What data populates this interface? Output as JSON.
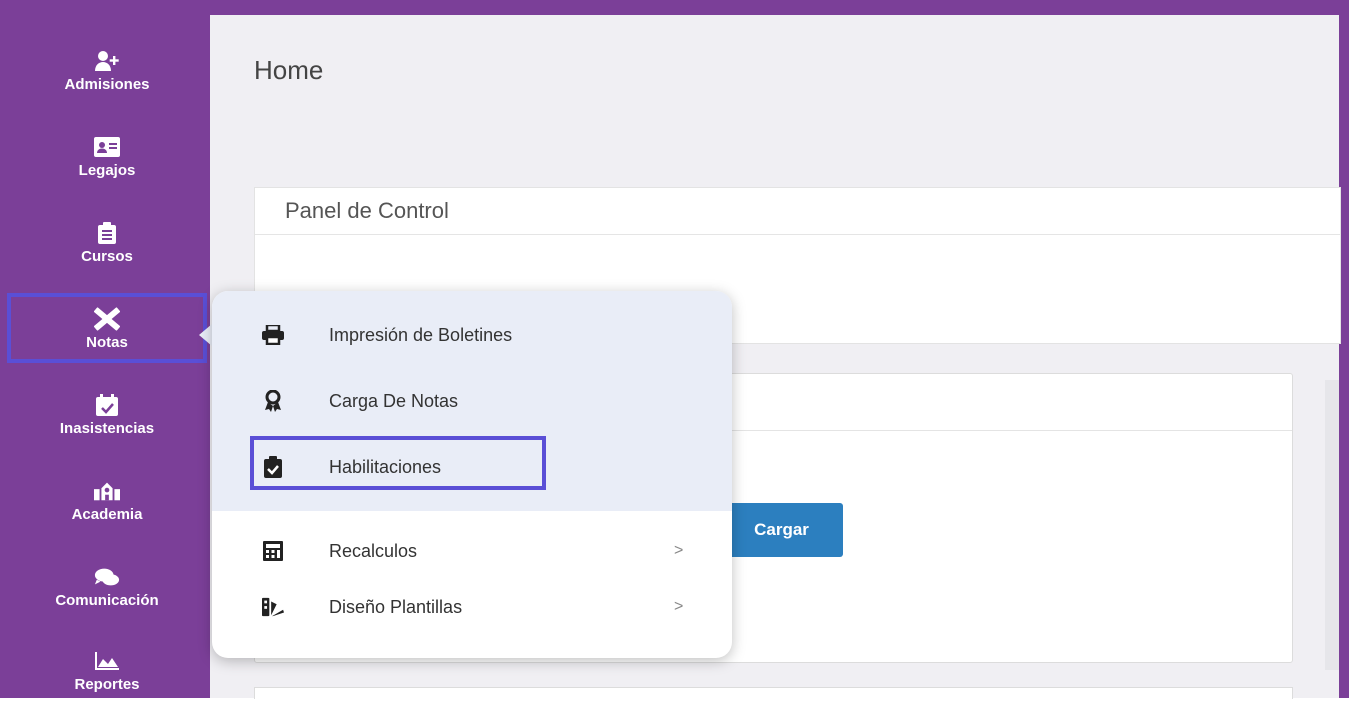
{
  "sidebar": {
    "items": [
      {
        "label": "Admisiones",
        "icon": "user-plus-icon"
      },
      {
        "label": "Legajos",
        "icon": "id-card-icon"
      },
      {
        "label": "Cursos",
        "icon": "clipboard-list-icon"
      },
      {
        "label": "Notas",
        "icon": "pencil-ruler-icon"
      },
      {
        "label": "Inasistencias",
        "icon": "calendar-check-icon"
      },
      {
        "label": "Academia",
        "icon": "school-icon"
      },
      {
        "label": "Comunicación",
        "icon": "comments-icon"
      },
      {
        "label": "Reportes",
        "icon": "area-chart-icon"
      }
    ],
    "active": "Notas"
  },
  "main": {
    "title": "Home",
    "panel_title": "Panel de Control",
    "cargar_label": "Cargar"
  },
  "popup_menu": {
    "items": [
      {
        "label": "Impresión de Boletines",
        "icon": "print-icon"
      },
      {
        "label": "Carga De Notas",
        "icon": "award-icon"
      },
      {
        "label": "Habilitaciones",
        "icon": "clipboard-check-icon",
        "highlighted": true
      },
      {
        "label": "Recalculos",
        "icon": "calculator-icon",
        "chevron": ">"
      },
      {
        "label": "Diseño Plantillas",
        "icon": "swatchbook-icon",
        "chevron": ">"
      }
    ]
  },
  "colors": {
    "sidebar": "#7b3f98",
    "highlight": "#5a4fd6",
    "button": "#2c7fbf",
    "popup_top": "#e9edf7"
  }
}
